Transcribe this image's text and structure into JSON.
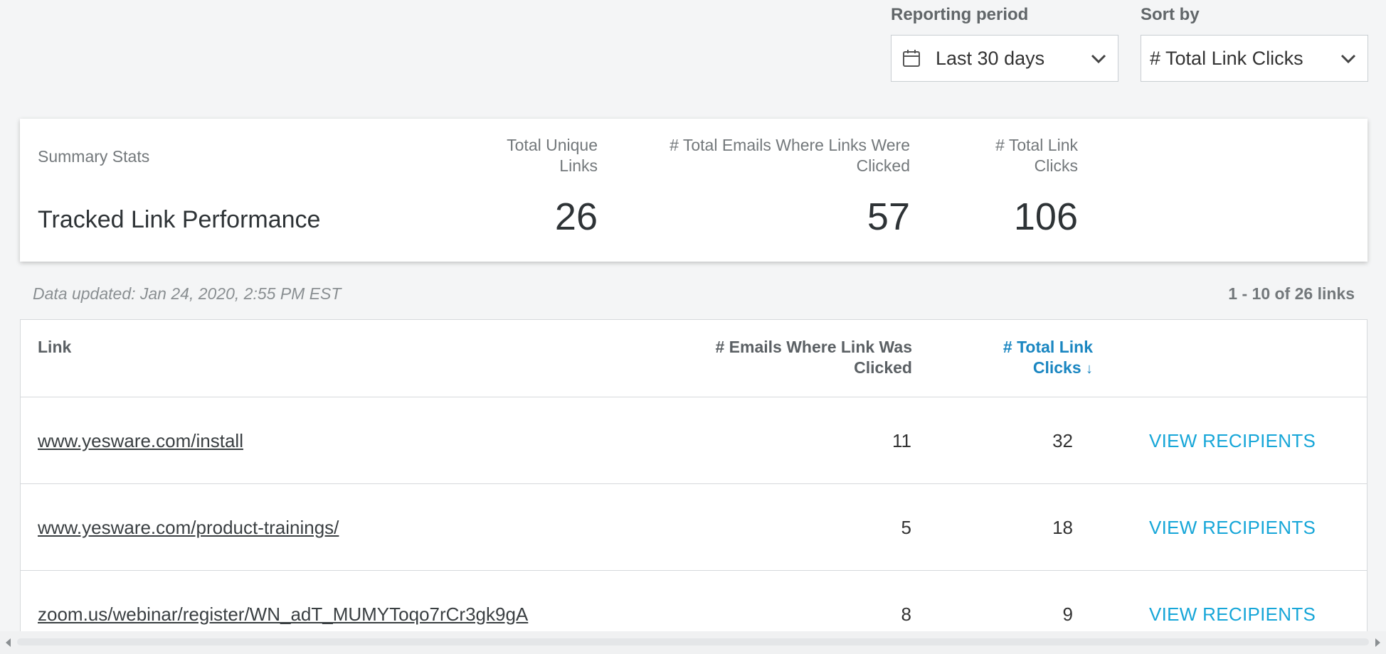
{
  "controls": {
    "reporting_period_label": "Reporting period",
    "reporting_period_value": "Last 30 days",
    "sort_by_label": "Sort by",
    "sort_by_value": "# Total Link Clicks"
  },
  "summary": {
    "label": "Summary Stats",
    "title": "Tracked Link Performance",
    "stats": [
      {
        "header": "Total Unique Links",
        "value": "26"
      },
      {
        "header": "# Total Emails Where Links Were Clicked",
        "value": "57"
      },
      {
        "header": "# Total Link Clicks",
        "value": "106"
      }
    ]
  },
  "meta": {
    "data_updated": "Data updated: Jan 24, 2020, 2:55 PM EST",
    "range_count": "1 - 10 of 26 links"
  },
  "table": {
    "columns": {
      "link": "Link",
      "emails": "# Emails Where Link Was Clicked",
      "clicks": "# Total Link Clicks",
      "clicks_sort_arrow": "↓"
    },
    "rows": [
      {
        "link": "www.yesware.com/install",
        "emails": "11",
        "clicks": "32",
        "action": "VIEW RECIPIENTS"
      },
      {
        "link": "www.yesware.com/product-trainings/",
        "emails": "5",
        "clicks": "18",
        "action": "VIEW RECIPIENTS"
      },
      {
        "link": "zoom.us/webinar/register/WN_adT_MUMYToqo7rCr3gk9gA",
        "emails": "8",
        "clicks": "9",
        "action": "VIEW RECIPIENTS"
      }
    ]
  },
  "icons": {
    "calendar": "calendar-icon",
    "chevron": "chevron-down-icon",
    "scroll_left": "scroll-left-arrow-icon",
    "scroll_right": "scroll-right-arrow-icon"
  },
  "colors": {
    "accent": "#16a6d8",
    "sort_active": "#1a86c1",
    "background": "#f4f5f6"
  }
}
